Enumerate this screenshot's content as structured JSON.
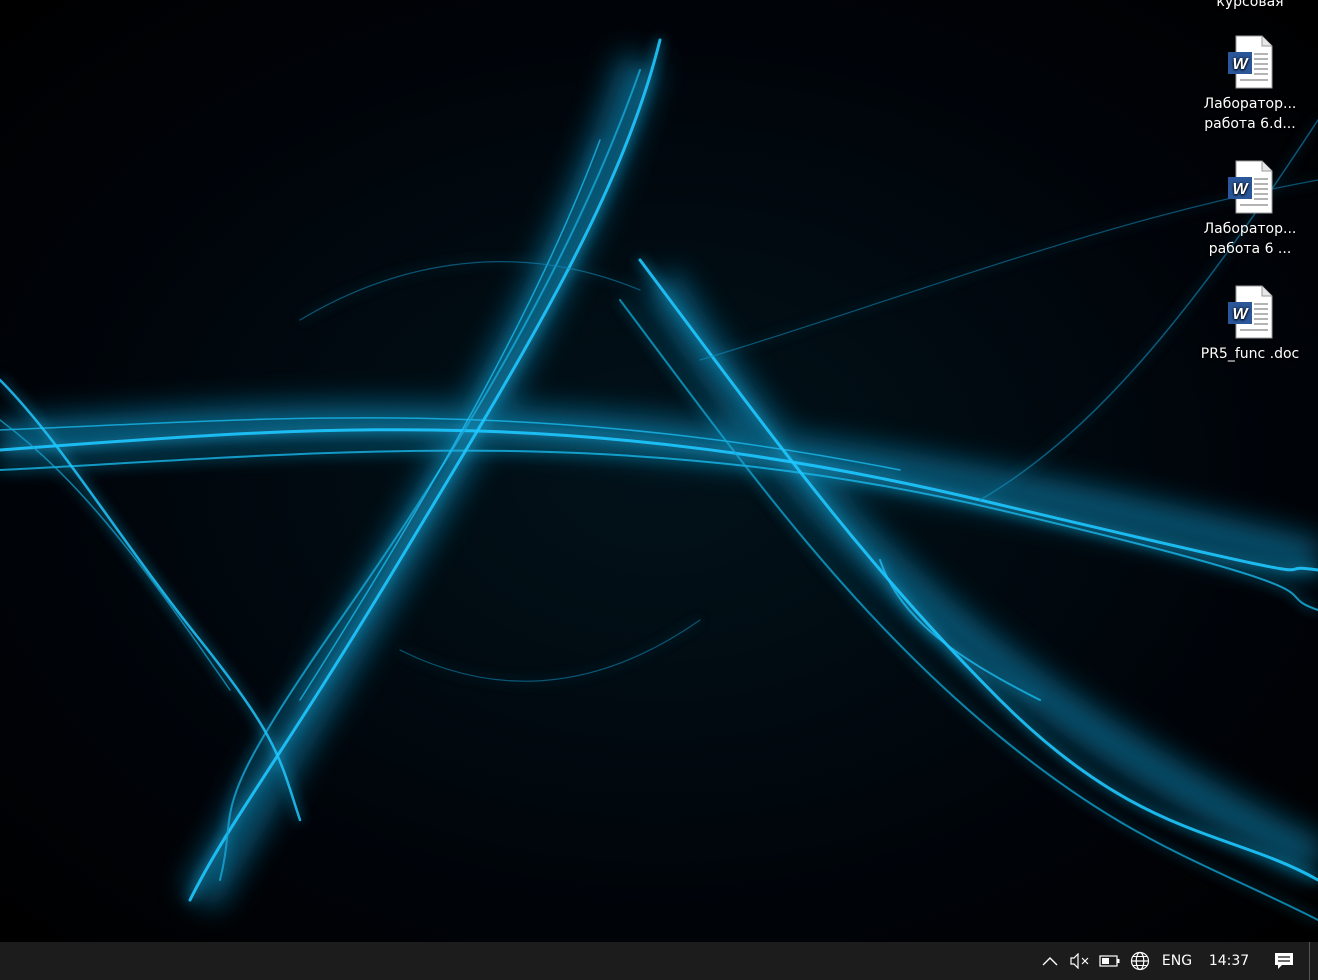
{
  "desktop": {
    "icons": [
      {
        "label": "курсовая",
        "icon": "folder-icon"
      },
      {
        "label_line1": "Лаборатор...",
        "label_line2": "работа 6.d...",
        "icon": "word-document-icon"
      },
      {
        "label_line1": "Лаборатор...",
        "label_line2": "работа 6 ...",
        "icon": "word-document-icon"
      },
      {
        "label": "PR5_func .doc",
        "icon": "word-document-icon"
      }
    ]
  },
  "taskbar": {
    "tray": {
      "chevron": "chevron-up-icon",
      "volume": "volume-muted-icon",
      "battery": "battery-icon",
      "network": "globe-network-icon",
      "language": "ENG",
      "time": "14:37",
      "notifications": "action-center-icon"
    }
  },
  "colors": {
    "accent": "#1ec8ff",
    "taskbar": "#1c1c1c",
    "word_blue": "#2b579a"
  }
}
